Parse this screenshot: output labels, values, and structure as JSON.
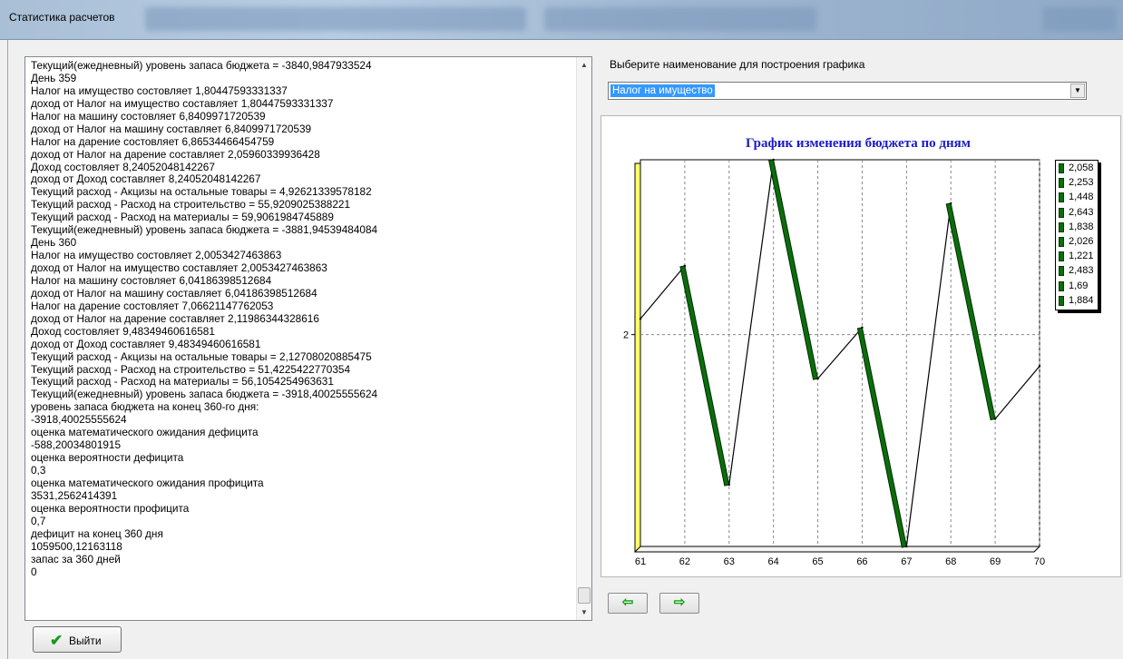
{
  "window": {
    "title": "Статистика расчетов"
  },
  "log": {
    "lines": [
      "Текущий(ежедневный) уровень запаса бюджета = -3840,9847933524",
      "День 359",
      "Налог на имущество состовляет 1,80447593331337",
      "доход от Налог на имущество составляет 1,80447593331337",
      "Налог на машину состовляет 6,8409971720539",
      "доход от Налог на машину составляет 6,8409971720539",
      "Налог на дарение состовляет 6,86534466454759",
      "доход от Налог на дарение составляет 2,05960339936428",
      "Доход состовляет 8,24052048142267",
      "доход от Доход составляет 8,24052048142267",
      "Текущий расход - Акцизы на остальные товары = 4,92621339578182",
      "Текущий расход - Расход на строительство = 55,9209025388221",
      "Текущий расход - Расход на материалы = 59,9061984745889",
      "Текущий(ежедневный) уровень запаса бюджета = -3881,94539484084",
      "День 360",
      "Налог на имущество состовляет 2,0053427463863",
      "доход от Налог на имущество составляет 2,0053427463863",
      "Налог на машину состовляет 6,04186398512684",
      "доход от Налог на машину составляет 6,04186398512684",
      "Налог на дарение состовляет 7,06621147762053",
      "доход от Налог на дарение составляет 2,11986344328616",
      "Доход состовляет 9,48349460616581",
      "доход от Доход составляет 9,48349460616581",
      "Текущий расход - Акцизы на остальные товары = 2,12708020885475",
      "Текущий расход - Расход на строительство = 51,4225422770354",
      "Текущий расход - Расход на материалы = 56,1054254963631",
      "Текущий(ежедневный) уровень запаса бюджета = -3918,40025555624",
      "уровень запаса бюджета на конец 360-го дня:",
      "-3918,40025555624",
      "оценка математического ожидания дефицита",
      "-588,20034801915",
      "оценка  вероятности дефицита",
      "0,3",
      "оценка математического ожидания профицита",
      "3531,2562414391",
      "оценка  вероятности профицита",
      "0,7",
      "дефицит на конец 360 дня",
      "1059500,12163118",
      "запас за 360 дней",
      "0"
    ]
  },
  "selector": {
    "label": "Выберите наименование для построения графика",
    "selected": "Налог на имущество"
  },
  "chart_data": {
    "type": "line",
    "title": "График изменения бюджета по дням",
    "x": [
      61,
      62,
      63,
      64,
      65,
      66,
      67,
      68,
      69,
      70
    ],
    "values": [
      2.058,
      2.253,
      1.448,
      2.643,
      1.838,
      2.026,
      1.221,
      2.483,
      1.69,
      1.884
    ],
    "xticks": [
      "61",
      "62",
      "63",
      "64",
      "65",
      "66",
      "67",
      "68",
      "69",
      "70"
    ],
    "yticks": [
      "2"
    ],
    "legend": [
      "2,058",
      "2,253",
      "1,448",
      "2,643",
      "1,838",
      "2,026",
      "1,221",
      "2,483",
      "1,69",
      "1,884"
    ],
    "legend_position": "right",
    "grid": true,
    "colors": {
      "series": "#0a6e0a",
      "title": "#1a1acc",
      "wall": "#ffff66"
    }
  },
  "nav": {
    "prev_icon": "arrow-left-icon",
    "next_icon": "arrow-right-icon"
  },
  "exit_button": {
    "label": "Выйти",
    "icon": "check-icon"
  }
}
